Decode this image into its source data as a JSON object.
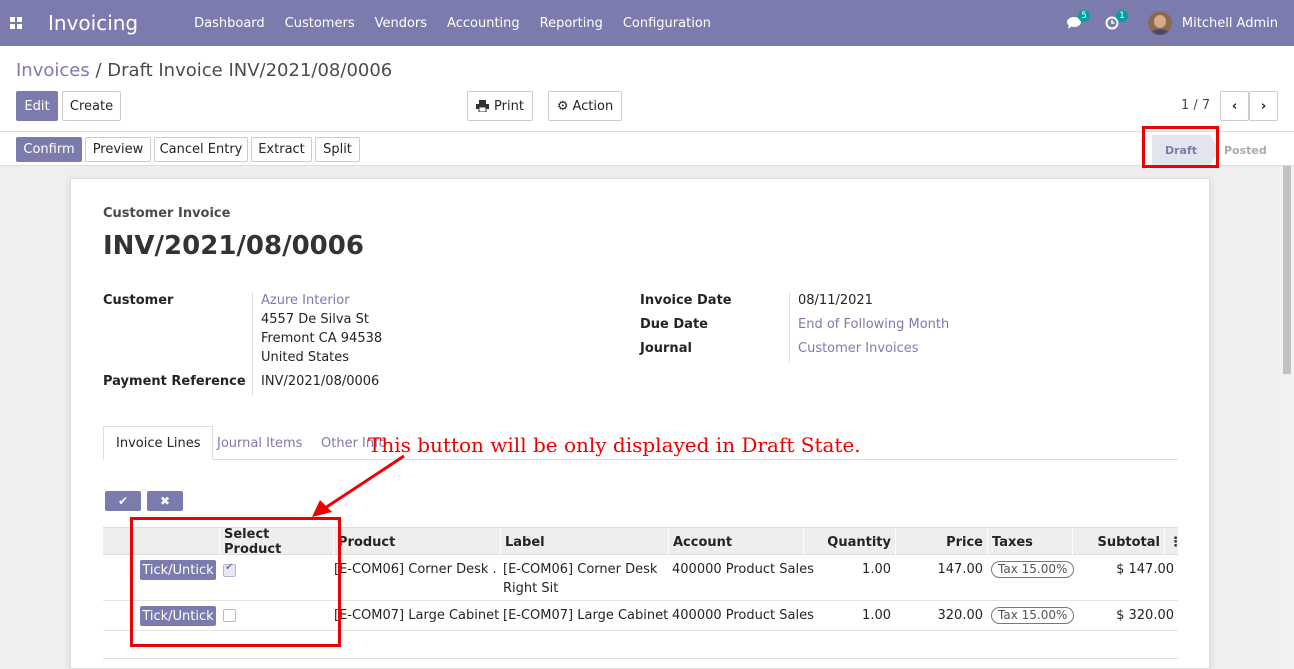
{
  "navbar": {
    "brand": "Invoicing",
    "menu": [
      "Dashboard",
      "Customers",
      "Vendors",
      "Accounting",
      "Reporting",
      "Configuration"
    ],
    "messages_count": "5",
    "activities_count": "1",
    "user": "Mitchell Admin"
  },
  "breadcrumb": {
    "parent": "Invoices",
    "separator": "/",
    "current": "Draft Invoice INV/2021/08/0006"
  },
  "buttons": {
    "edit": "Edit",
    "create": "Create",
    "print": "Print",
    "action": "Action"
  },
  "pager": {
    "value": "1 / 7"
  },
  "status_buttons": {
    "confirm": "Confirm",
    "preview": "Preview",
    "cancel_entry": "Cancel Entry",
    "extract": "Extract",
    "split": "Split"
  },
  "stages": {
    "draft": "Draft",
    "posted": "Posted"
  },
  "invoice": {
    "type": "Customer Invoice",
    "name": "INV/2021/08/0006",
    "customer_label": "Customer",
    "customer_name": "Azure Interior",
    "address_line1": "4557 De Silva St",
    "address_line2": "Fremont CA 94538",
    "address_line3": "United States",
    "payment_ref_label": "Payment Reference",
    "payment_ref": "INV/2021/08/0006",
    "invoice_date_label": "Invoice Date",
    "invoice_date": "08/11/2021",
    "due_date_label": "Due Date",
    "due_date": "End of Following Month",
    "journal_label": "Journal",
    "journal": "Customer Invoices"
  },
  "tabs": [
    "Invoice Lines",
    "Journal Items",
    "Other Info"
  ],
  "table": {
    "headers": [
      "Select Product",
      "Product",
      "Label",
      "Account",
      "Quantity",
      "Price",
      "Taxes",
      "Subtotal"
    ],
    "rows": [
      {
        "button": "Tick/Untick",
        "selected": true,
        "product": "[E-COM06] Corner Desk ...",
        "label1": "[E-COM06] Corner Desk",
        "label2": "Right Sit",
        "account": "400000 Product Sales",
        "quantity": "1.00",
        "price": "147.00",
        "tax": "Tax 15.00%",
        "subtotal": "$ 147.00"
      },
      {
        "button": "Tick/Untick",
        "selected": false,
        "product": "[E-COM07] Large Cabinet",
        "label1": "[E-COM07] Large Cabinet",
        "label2": "",
        "account": "400000 Product Sales",
        "quantity": "1.00",
        "price": "320.00",
        "tax": "Tax 15.00%",
        "subtotal": "$ 320.00"
      }
    ]
  },
  "annotation": "This button will be only displayed in Draft State.",
  "colors": {
    "brand": "#7c7bad",
    "annotation": "#ee0000"
  }
}
